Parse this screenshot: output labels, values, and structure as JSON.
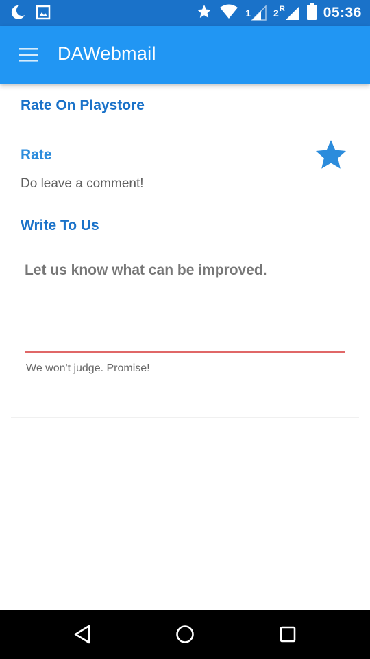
{
  "status_bar": {
    "time": "05:36",
    "sim1_label": "1",
    "sim2_label": "2",
    "roaming_label": "R",
    "icons": [
      "moon-icon",
      "image-notification-icon",
      "star-icon",
      "wifi-icon",
      "signal-sim1-icon",
      "signal-sim2-icon",
      "battery-icon"
    ]
  },
  "app_bar": {
    "title": "DAWebmail",
    "menu_icon": "hamburger-menu-icon"
  },
  "content": {
    "rate_section_header": "Rate On Playstore",
    "rate_title": "Rate",
    "rate_subtitle": "Do leave a comment!",
    "rate_icon": "star-icon",
    "write_section_header": "Write To Us",
    "feedback_placeholder": "Let us know what can be improved.",
    "feedback_value": "",
    "helper_text": "We won't judge. Promise!"
  },
  "nav_bar": {
    "icons": [
      "back-icon",
      "home-icon",
      "recents-icon"
    ]
  },
  "colors": {
    "status_bar": "#1a72c9",
    "app_bar": "#2196f3",
    "accent": "#2c8cdc",
    "section_header": "#1a72c9",
    "input_underline": "#e06767"
  }
}
